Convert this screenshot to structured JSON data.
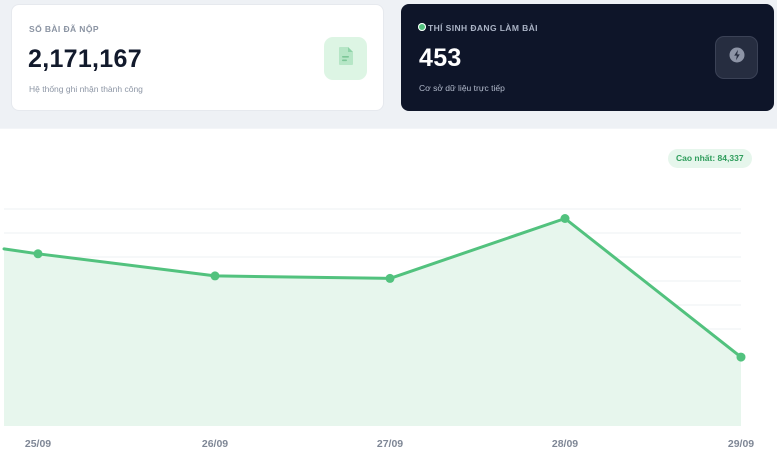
{
  "cards": {
    "submissions": {
      "label": "SỐ BÀI ĐÃ NỘP",
      "value": "2,171,167",
      "subtitle": "Hệ thống ghi nhận thành công",
      "icon": "document-icon"
    },
    "active_candidates": {
      "label": "THÍ SINH ĐANG LÀM BÀI",
      "value": "453",
      "subtitle": "Cơ sở dữ liệu trực tiếp",
      "icon": "lightning-icon",
      "live_indicator_color": "#52c27e"
    }
  },
  "chart": {
    "peak_badge": "Cao nhất: 84,337"
  },
  "colors": {
    "accent": "#52c27e",
    "dark_card": "#0e1529"
  },
  "chart_data": {
    "type": "area",
    "categories": [
      "25/09",
      "26/09",
      "27/09",
      "28/09",
      "29/09"
    ],
    "series": [
      {
        "values": [
          70000,
          61000,
          60000,
          84337,
          28000
        ]
      }
    ],
    "leading_value": 72000,
    "ylim": [
      0,
      100000
    ],
    "grid": true
  }
}
